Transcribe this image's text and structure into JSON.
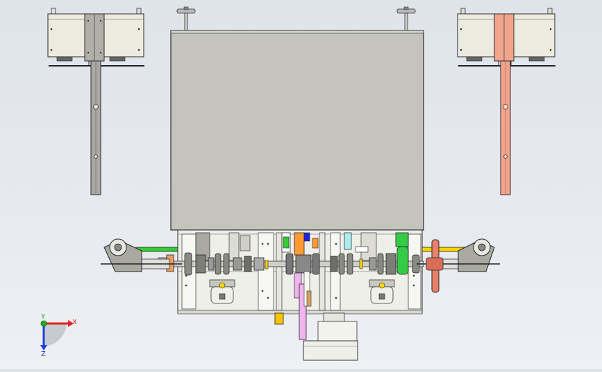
{
  "viewport": {
    "background_top": "#dfe3ea",
    "background_bottom": "#eef0f4"
  },
  "triad": {
    "x_label": "X",
    "y_label": "Y",
    "z_label": "Z",
    "x_color": "#e02020",
    "y_color": "#20b020",
    "z_color": "#2040e0"
  },
  "colors": {
    "panel_fill": "#c4c4bc",
    "frame_fill": "#efefea",
    "arm_gray": "#a9a9a1",
    "arm_salmon": "#f3a48c",
    "rail_green": "#33cc33",
    "rail_yellow": "#f5d400",
    "wheel_salmon": "#e8806a",
    "pink_bar": "#f0b4ee",
    "cyan_block": "#a8eef0",
    "orange_block": "#ff9933",
    "blue_block": "#2222dd",
    "green_block": "#33cc44",
    "edge": "#2a2a2a"
  },
  "icons": {
    "triad": "coordinate-triad-icon",
    "handwheel": "handwheel-icon"
  }
}
